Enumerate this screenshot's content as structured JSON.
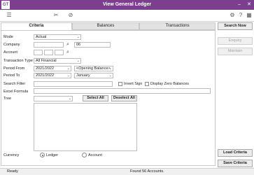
{
  "window": {
    "app_icon": "GT",
    "title": "View General Ledger"
  },
  "toolbar": {
    "icons": [
      "list-icon",
      "tools-icon",
      "lock-icon",
      "settings-icon",
      "help-icon",
      "grid-icon"
    ]
  },
  "tabs": [
    {
      "label": "Criteria",
      "active": true
    },
    {
      "label": "Balances",
      "active": false
    },
    {
      "label": "Transactions",
      "active": false
    }
  ],
  "form": {
    "mode": {
      "label": "Mode",
      "value": "Actual"
    },
    "company": {
      "label": "Company",
      "value": "",
      "code": "06"
    },
    "account": {
      "label": "Account",
      "seg1": "",
      "seg2": "",
      "seg3": ""
    },
    "transaction_type": {
      "label": "Transaction Type",
      "value": "All Financial"
    },
    "period_from": {
      "label": "Period From",
      "year": "2021/2022",
      "period": "<Opening Balance>"
    },
    "period_to": {
      "label": "Period To",
      "year": "2021/2022",
      "period": "January"
    },
    "search_filter": {
      "label": "Search Filter",
      "value": ""
    },
    "invert_sign": {
      "label": "Invert Sign",
      "checked": false
    },
    "display_zero": {
      "label": "Display Zero Balances",
      "checked": false
    },
    "excel_formula": {
      "label": "Excel Formula",
      "value": ""
    },
    "tree": {
      "label": "Tree",
      "value": "",
      "select_all": "Select All",
      "deselect_all": "Deselect All"
    },
    "currency": {
      "label": "Currency",
      "options": [
        "Ledger",
        "Account"
      ],
      "selected": "Ledger"
    }
  },
  "side_buttons": {
    "search_now": "Search Now",
    "enquiry": "Enquiry",
    "maintain": "Maintain",
    "load_criteria": "Load Criteria",
    "save_criteria": "Save Criteria"
  },
  "status": {
    "left": "Ready",
    "center": "Found 56 Accounts."
  }
}
